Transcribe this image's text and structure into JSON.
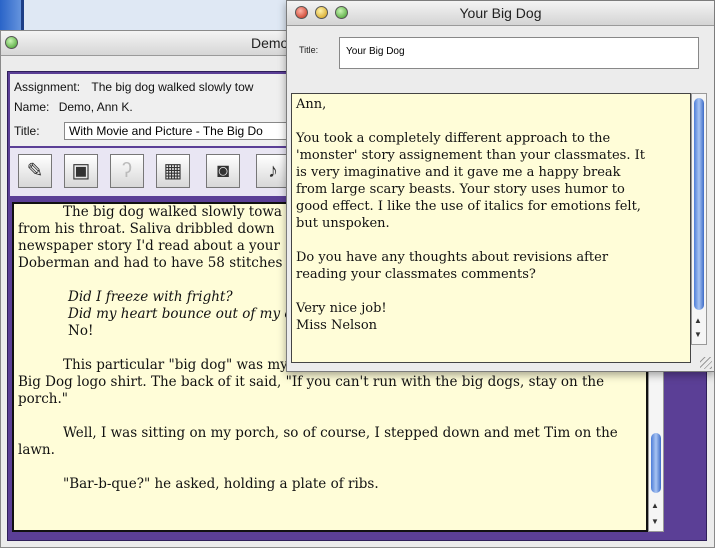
{
  "main_window": {
    "title": "Demo",
    "assignment_label": "Assignment:",
    "assignment_value": "The big dog walked slowly tow",
    "name_label": "Name:",
    "name_value": "Demo, Ann K.",
    "title_label": "Title:",
    "title_value": "With Movie and Picture - The Big Do",
    "toolbar": [
      {
        "icon": "notepad-pencil-icon"
      },
      {
        "icon": "picture-icon"
      },
      {
        "icon": "ear-icon"
      },
      {
        "icon": "film-icon"
      },
      {
        "icon": "camera-icon"
      },
      {
        "icon": "microphone-icon"
      }
    ],
    "essay": {
      "p1_l1": "The big dog walked slowly towa",
      "p1_l2": "from his throat. Saliva dribbled down",
      "p1_l3": "newspaper story I'd read about a your",
      "p1_l4": "Doberman and had to have 58 stitches",
      "i1": "Did I freeze with fright?",
      "i2": "Did my heart bounce out of my che",
      "no": "No!",
      "p2_l1": "This particular \"big dog\" was my neighbor Tim who was showing off his new",
      "p2_l2": "Big Dog logo shirt. The back of it said, \"If you can't run with the big dogs, stay on the",
      "p2_l3": "porch.\"",
      "p3_l1": "Well, I was sitting on my porch, so of course, I stepped down and met Tim on the",
      "p3_l2": "lawn.",
      "p4_l1": "\"Bar-b-que?\" he asked, holding a plate of ribs."
    }
  },
  "comment_window": {
    "title": "Your Big Dog",
    "title_label": "Title:",
    "title_value": "Your Big Dog",
    "greeting": "Ann,",
    "body_l1": "You took a completely different approach to the",
    "body_l2": "'monster' story assignement than your classmates. It",
    "body_l3": "is very imaginative and it gave me a happy break",
    "body_l4": "from large scary beasts. Your story uses humor to",
    "body_l5": "good effect. I like the use of italics for emotions felt,",
    "body_l6": "but unspoken.",
    "q_l1": "Do you have any thoughts about revisions after",
    "q_l2": "reading your classmates comments?",
    "closing": "Very nice job!",
    "signature": "Miss Nelson"
  },
  "colors": {
    "frame_purple": "#5b3f96",
    "paper": "#fffdd8",
    "scroll_thumb": "#4d7dd8"
  }
}
